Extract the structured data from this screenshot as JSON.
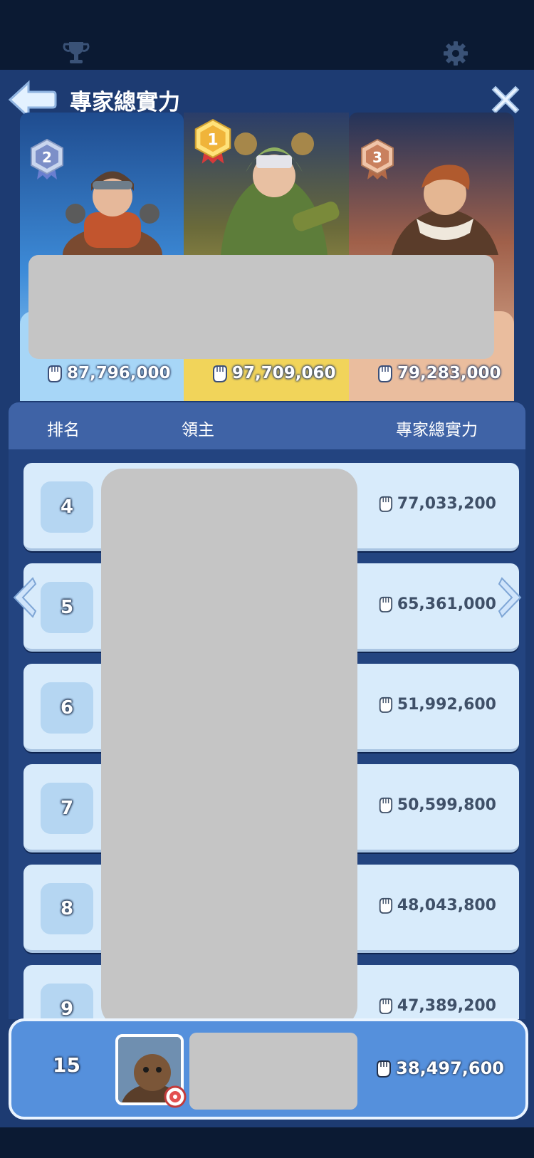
{
  "header": {
    "title": "專家總實力"
  },
  "podium": [
    {
      "rank": "2",
      "score": "87,796,000",
      "color": "#a7d6f7"
    },
    {
      "rank": "1",
      "score": "97,709,060",
      "color": "#f1d45a"
    },
    {
      "rank": "3",
      "score": "79,283,000",
      "color": "#eabd9e"
    }
  ],
  "columns": {
    "rank": "排名",
    "lord": "領主",
    "power": "專家總實力"
  },
  "rows": [
    {
      "rank": "4",
      "score": "77,033,200"
    },
    {
      "rank": "5",
      "score": "65,361,000"
    },
    {
      "rank": "6",
      "score": "51,992,600"
    },
    {
      "rank": "7",
      "score": "50,599,800"
    },
    {
      "rank": "8",
      "score": "48,043,800"
    },
    {
      "rank": "9",
      "score": "47,389,200"
    }
  ],
  "me": {
    "rank": "15",
    "score": "38,497,600"
  },
  "icons": {
    "trophy": "trophy-icon",
    "gear": "gear-icon",
    "back": "back-arrow-icon",
    "close": "close-icon",
    "fist": "fist-icon",
    "prev": "chevron-left-icon",
    "next": "chevron-right-icon"
  }
}
